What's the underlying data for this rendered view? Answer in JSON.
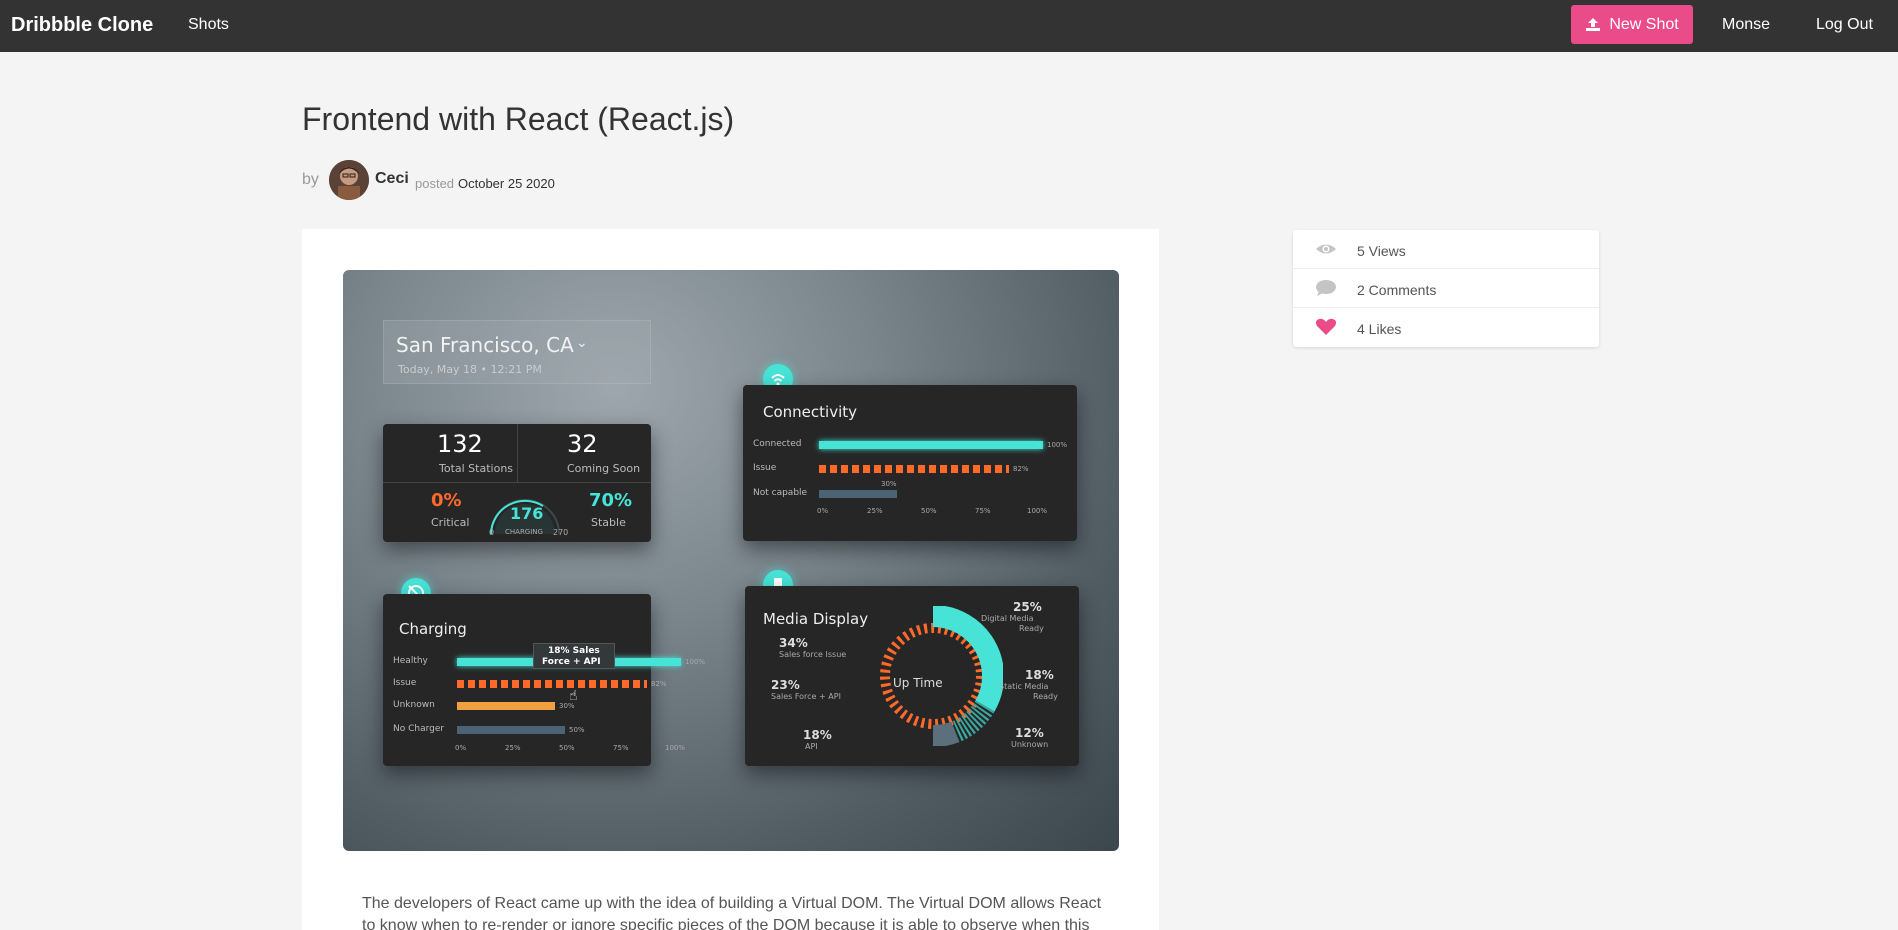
{
  "nav": {
    "brand": "Dribbble Clone",
    "shots": "Shots",
    "new_shot": "New Shot",
    "user": "Monse",
    "logout": "Log Out"
  },
  "shot": {
    "title": "Frontend with React (React.js)",
    "by": "by",
    "author": "Ceci",
    "posted_label": "posted",
    "date": "October 25 2020",
    "description": "The developers of React came up with the idea of building a Virtual DOM. The Virtual DOM allows React to know when to re-render or ignore specific pieces of the DOM because it is able to observe when this"
  },
  "stats": {
    "views": "5 Views",
    "comments": "2 Comments",
    "likes": "4 Likes"
  },
  "image": {
    "location": "San Francisco, CA",
    "datetime": "Today, May 18 • 12:21 PM",
    "total_stations_value": "132",
    "total_stations_label": "Total Stations",
    "coming_soon_value": "32",
    "coming_soon_label": "Coming Soon",
    "critical_value": "0%",
    "critical_label": "Critical",
    "charging_value": "176",
    "charging_label": "CHARGING",
    "gauge_min": "0",
    "gauge_max": "270",
    "stable_value": "70%",
    "stable_label": "Stable",
    "connectivity_title": "Connectivity",
    "conn_connected": "Connected",
    "conn_issue": "Issue",
    "conn_not_capable": "Not capable",
    "conn_connected_pct": "100%",
    "conn_issue_pct": "82%",
    "conn_not_capable_pct": "30%",
    "axis_ticks": [
      "0%",
      "25%",
      "50%",
      "75%",
      "100%"
    ],
    "charging_title": "Charging",
    "ch_healthy": "Healthy",
    "ch_issue": "Issue",
    "ch_unknown": "Unknown",
    "ch_no_charger": "No Charger",
    "ch_healthy_pct": "100%",
    "ch_issue_pct": "82%",
    "ch_unknown_pct": "30%",
    "ch_no_charger_pct": "50%",
    "tooltip_line1": "18% Sales",
    "tooltip_line2": "Force + API",
    "media_title": "Media Display",
    "media_center": "Up Time",
    "m_34": "34%",
    "m_34_label": "Sales force Issue",
    "m_23": "23%",
    "m_23_label": "Sales Force + API",
    "m_18a": "18%",
    "m_18a_label": "API",
    "m_25": "25%",
    "m_25_label1": "Digital Media",
    "m_25_label2": "Ready",
    "m_18b": "18%",
    "m_18b_label1": "Static Media",
    "m_18b_label2": "Ready",
    "m_12": "12%",
    "m_12_label": "Unknown"
  },
  "colors": {
    "nav_bg": "#333333",
    "accent_pink": "#ea4c89",
    "teal": "#47e3d7",
    "orange": "#ff6a2b"
  }
}
